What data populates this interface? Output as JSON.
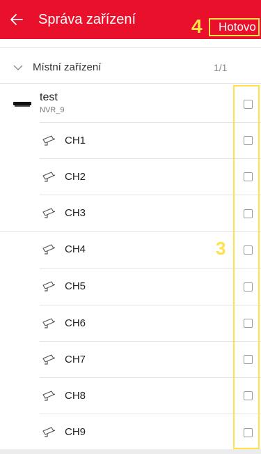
{
  "header": {
    "title": "Správa zařízení",
    "done_label": "Hotovo",
    "callout_number": "4",
    "background": "#e8102a"
  },
  "group": {
    "label": "Místní zařízení",
    "count": "1/1"
  },
  "device": {
    "name": "test",
    "model": "NVR_9"
  },
  "channels": [
    {
      "label": "CH1"
    },
    {
      "label": "CH2"
    },
    {
      "label": "CH3"
    },
    {
      "label": "CH4"
    },
    {
      "label": "CH5"
    },
    {
      "label": "CH6"
    },
    {
      "label": "CH7"
    },
    {
      "label": "CH8"
    },
    {
      "label": "CH9"
    }
  ],
  "annotations": {
    "checkbox_column_number": "3",
    "highlight_color": "#ffe14a"
  },
  "icons": {
    "back": "arrow-left-icon",
    "group_toggle": "chevron-down-icon",
    "device": "nvr-device-icon",
    "channel": "camera-icon"
  }
}
